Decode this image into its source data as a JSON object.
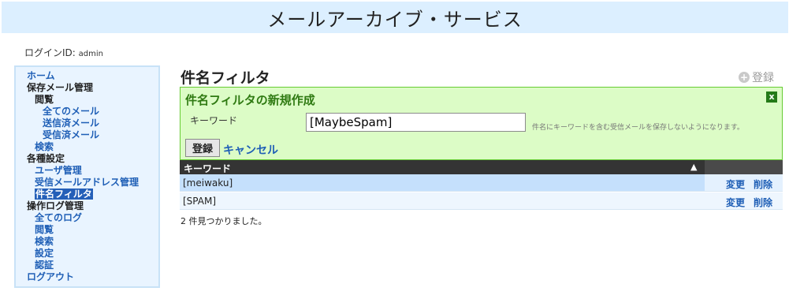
{
  "header": {
    "title": "メールアーカイブ・サービス"
  },
  "login": {
    "label": "ログインID: ",
    "user": "admin"
  },
  "sidebar": {
    "home": "ホーム",
    "saved_mail": "保存メール管理",
    "browse": "閲覧",
    "all_mail": "全てのメール",
    "sent_mail": "送信済メール",
    "received_mail": "受信済メール",
    "search": "検索",
    "settings": "各種設定",
    "user_mgmt": "ユーザ管理",
    "recv_addr_mgmt": "受信メールアドレス管理",
    "subject_filter": "件名フィルタ",
    "oplog_mgmt": "操作ログ管理",
    "all_logs": "全てのログ",
    "log_browse": "閲覧",
    "log_search": "検索",
    "log_settings": "設定",
    "log_auth": "認証",
    "logout": "ログアウト"
  },
  "main": {
    "title": "件名フィルタ",
    "register_link": "登録"
  },
  "form": {
    "title": "件名フィルタの新規作成",
    "close_label": "x",
    "keyword_label": "キーワード",
    "keyword_value": "[MaybeSpam]",
    "hint": "件名にキーワードを含む受信メールを保存しないようになります。",
    "submit_label": "登録",
    "cancel_label": "キャンセル"
  },
  "table": {
    "header_keyword": "キーワード",
    "edit_label": "変更",
    "delete_label": "削除",
    "rows": [
      {
        "keyword": "[meiwaku]"
      },
      {
        "keyword": "[SPAM]"
      }
    ],
    "result_count": "2 件見つかりました。"
  }
}
